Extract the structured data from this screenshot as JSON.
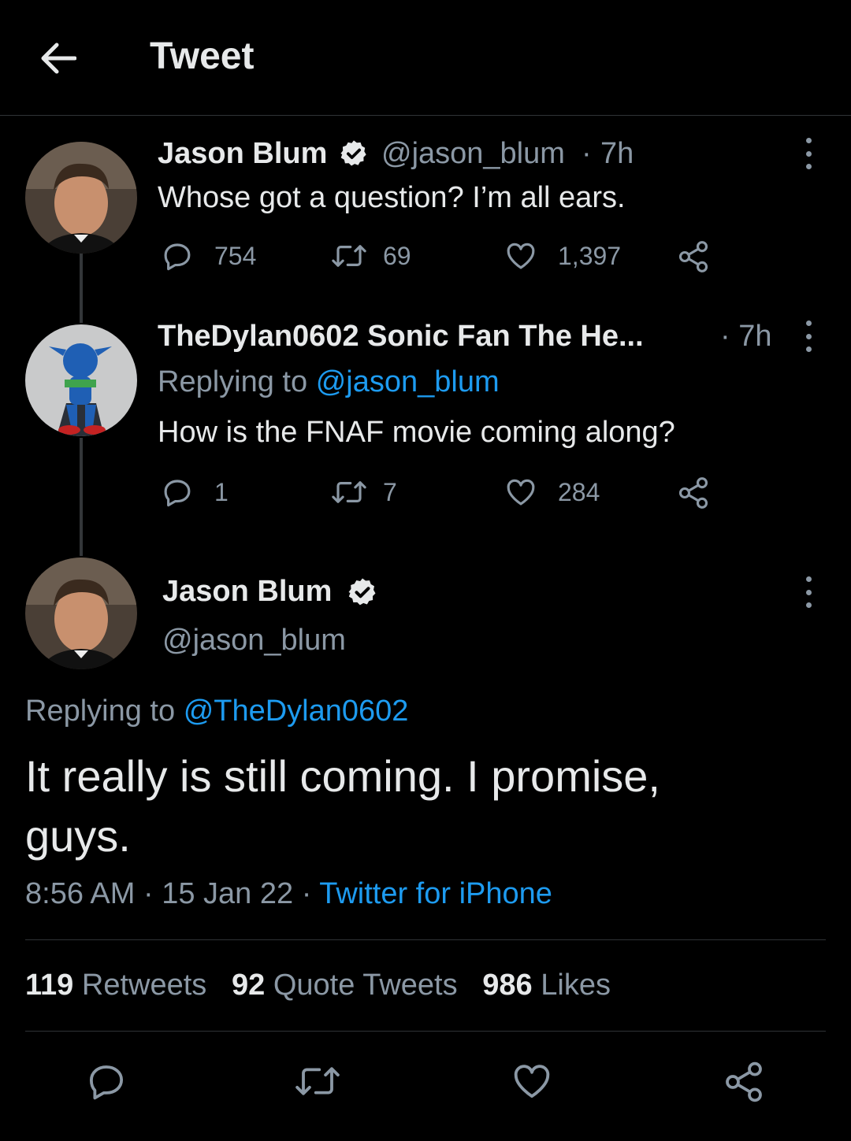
{
  "header": {
    "title": "Tweet"
  },
  "tweet1": {
    "name": "Jason Blum",
    "handle": "@jason_blum",
    "sep": "·",
    "time": "7h",
    "text": "Whose got a question?   I’m all ears.",
    "replies": "754",
    "retweets": "69",
    "likes": "1,397"
  },
  "tweet2": {
    "name": "TheDylan0602 Sonic Fan The He...",
    "time": "· 7h",
    "replying_prefix": "Replying to",
    "replying_handle": "@jason_blum",
    "text": "How is the FNAF movie coming along?",
    "replies": "1",
    "retweets": "7",
    "likes": "284"
  },
  "main": {
    "name": "Jason Blum",
    "handle": "@jason_blum",
    "replying_prefix": "Replying to",
    "replying_handle": "@TheDylan0602",
    "text_line1": "It really is still coming.   I promise,",
    "text_line2": "guys.",
    "time": "8:56 AM",
    "sep1": "·",
    "date": "15 Jan 22",
    "sep2": "·",
    "source": "Twitter for iPhone",
    "stats": {
      "retweets_count": "119",
      "retweets_label": "Retweets",
      "quotes_count": "92",
      "quotes_label": "Quote Tweets",
      "likes_count": "986",
      "likes_label": "Likes"
    }
  },
  "colors": {
    "background": "#000000",
    "text": "#e7e9ea",
    "secondary": "#8b98a5",
    "accent": "#1d9bf0"
  },
  "icons": [
    "back-arrow-icon",
    "verified-badge-icon",
    "more-icon",
    "reply-icon",
    "retweet-icon",
    "like-icon",
    "share-icon"
  ]
}
